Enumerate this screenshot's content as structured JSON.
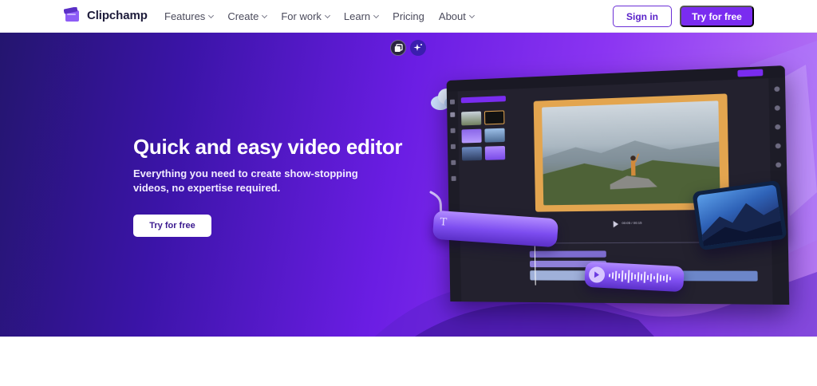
{
  "brand": {
    "name": "Clipchamp",
    "accent": "#7a2cf0"
  },
  "nav": {
    "items": [
      {
        "label": "Features",
        "has_dropdown": true
      },
      {
        "label": "Create",
        "has_dropdown": true
      },
      {
        "label": "For work",
        "has_dropdown": true
      },
      {
        "label": "Learn",
        "has_dropdown": true
      },
      {
        "label": "Pricing",
        "has_dropdown": false
      },
      {
        "label": "About",
        "has_dropdown": true
      }
    ],
    "sign_in": "Sign in",
    "try_free": "Try for free"
  },
  "hero": {
    "title": "Quick and easy video editor",
    "subtitle": "Everything you need to create show-stopping videos, no expertise required.",
    "cta": "Try for free",
    "icons": [
      "copy-icon",
      "sparkle-icon"
    ]
  },
  "editor_mockup": {
    "text_pill_glyph": "T",
    "playback_time": "00:05 / 00:15"
  },
  "next_section": {
    "heading_peek": ""
  }
}
